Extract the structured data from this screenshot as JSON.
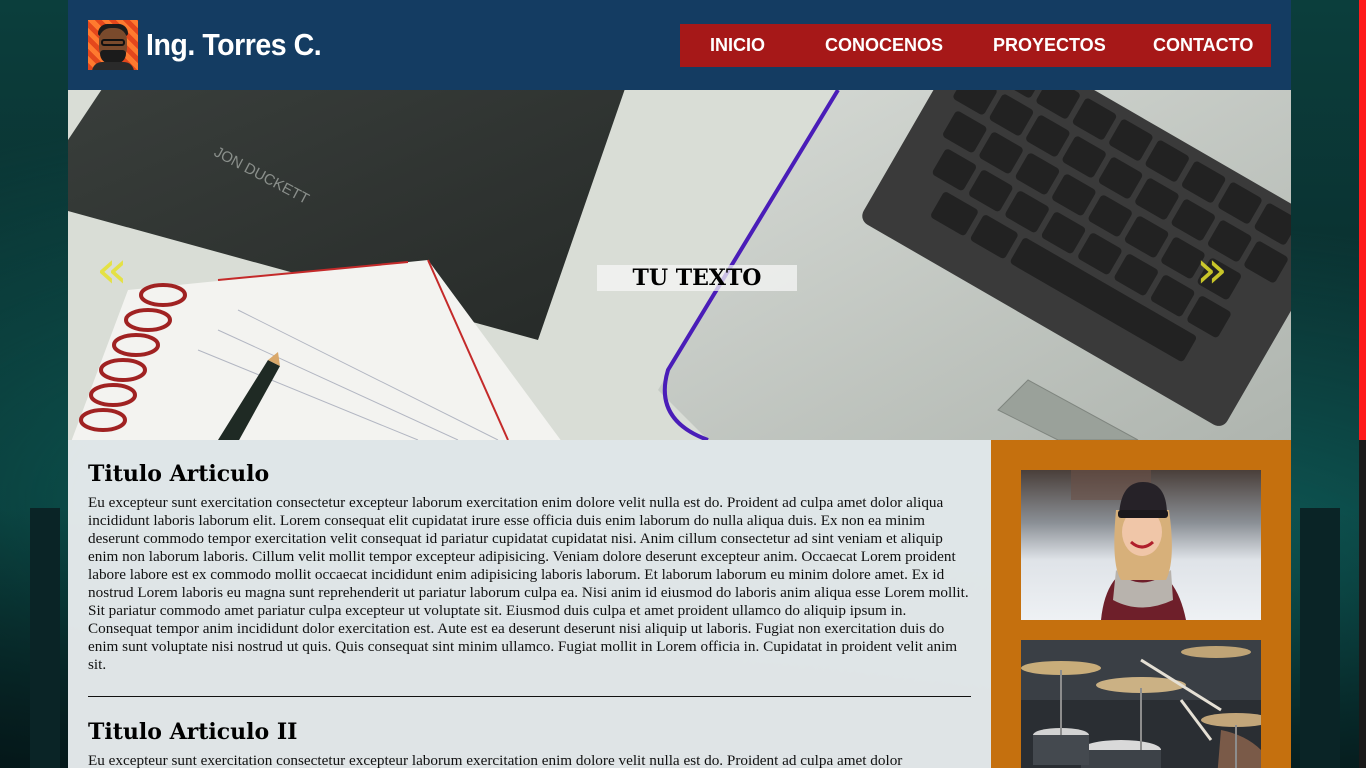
{
  "header": {
    "brand": "Ing. Torres C.",
    "nav": [
      {
        "label": "INICIO"
      },
      {
        "label": "CONOCENOS"
      },
      {
        "label": "PROYECTOS"
      },
      {
        "label": "CONTACTO"
      }
    ]
  },
  "hero": {
    "caption": "TU TEXTO",
    "prev_arrow": "«",
    "next_arrow": "»",
    "book_text": "JON DUCKETT"
  },
  "articles": [
    {
      "title": "Titulo Articulo",
      "body": "Eu excepteur sunt exercitation consectetur excepteur laborum exercitation enim dolore velit nulla est do. Proident ad culpa amet dolor aliqua incididunt laboris laborum elit. Lorem consequat elit cupidatat irure esse officia duis enim laborum do nulla aliqua duis. Ex non ea minim deserunt commodo tempor exercitation velit consequat id pariatur cupidatat cupidatat nisi. Anim cillum consectetur ad sint veniam et aliquip enim non laborum laboris. Cillum velit mollit tempor excepteur adipisicing. Veniam dolore deserunt excepteur anim. Occaecat Lorem proident labore labore est ex commodo mollit occaecat incididunt enim adipisicing laboris laborum. Et laborum laborum eu minim dolore amet. Ex id nostrud Lorem laboris eu magna sunt reprehenderit ut pariatur laborum culpa ea. Nisi anim id eiusmod do laboris anim aliqua esse Lorem mollit. Sit pariatur commodo amet pariatur culpa excepteur ut voluptate sit. Eiusmod duis culpa et amet proident ullamco do aliquip ipsum in. Consequat tempor anim incididunt dolor exercitation est. Aute est ea deserunt deserunt nisi aliquip ut laboris. Fugiat non exercitation duis do enim sunt voluptate nisi nostrud ut quis. Quis consequat sint minim ullamco. Fugiat mollit in Lorem officia in. Cupidatat in proident velit anim sit."
    },
    {
      "title": "Titulo Articulo II",
      "body": "Eu excepteur sunt exercitation consectetur excepteur laborum exercitation enim dolore velit nulla est do. Proident ad culpa amet dolor"
    }
  ],
  "colors": {
    "header_bg": "#143c62",
    "nav_bg": "#a61818",
    "aside_bg": "#c5700e",
    "arrow": "#e6e22b",
    "scrollbar_thumb": "#ff1a1a"
  },
  "icons": {
    "logo": "avatar-logo-icon",
    "prev": "chevron-double-left-icon",
    "next": "chevron-double-right-icon"
  }
}
